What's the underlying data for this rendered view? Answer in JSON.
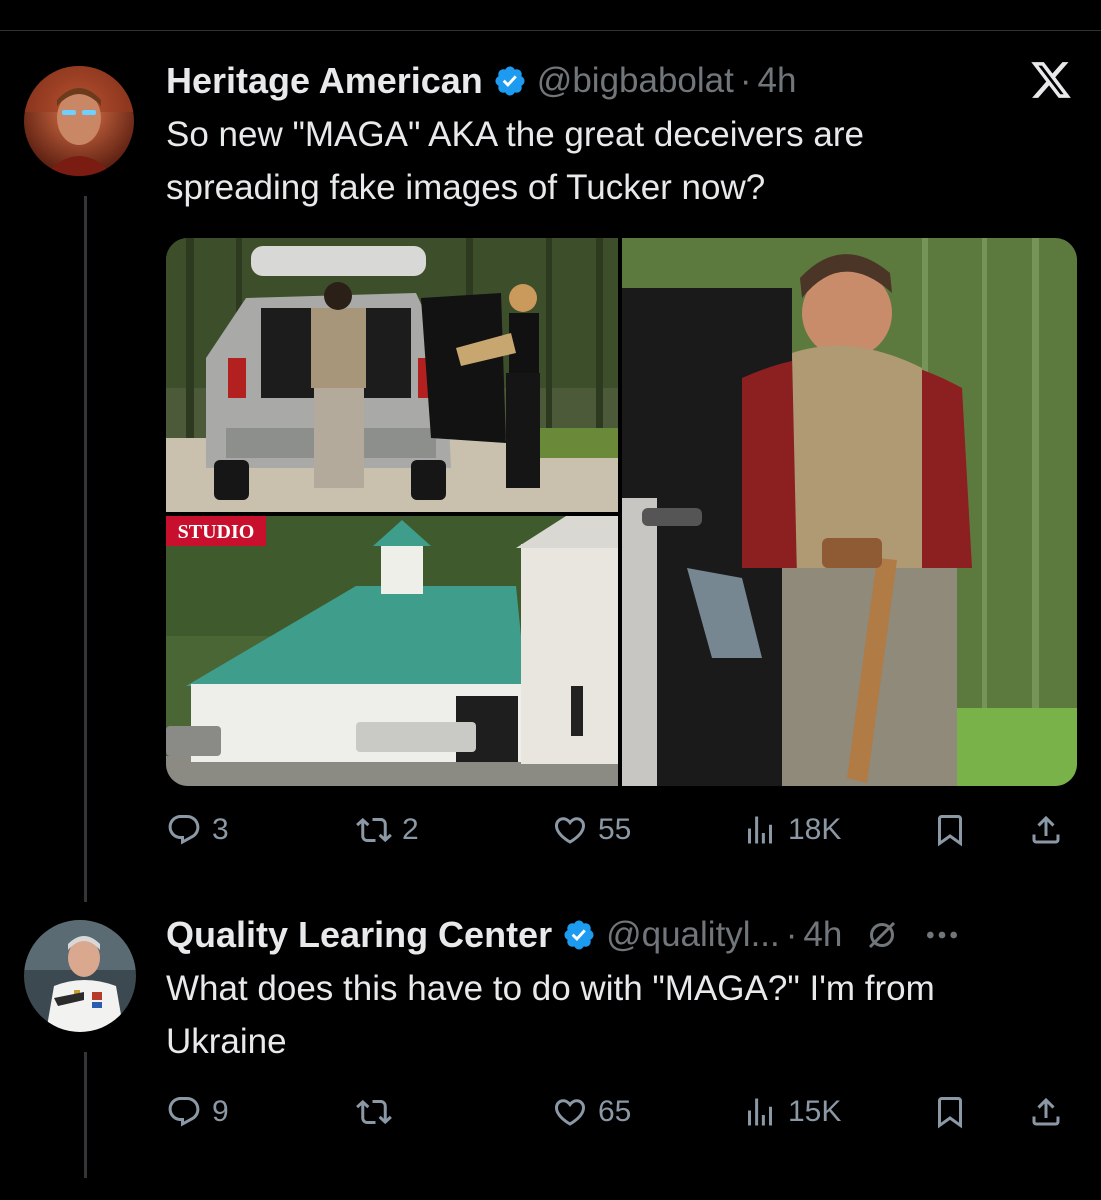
{
  "tweets": [
    {
      "display_name": "Heritage American",
      "handle": "@bigbabolat",
      "separator": "·",
      "time": "4h",
      "text": "So new \"MAGA\" AKA the great deceivers are spreading fake images of Tucker now?",
      "media_label": "STUDIO",
      "stats": {
        "replies": "3",
        "reposts": "2",
        "likes": "55",
        "views": "18K"
      }
    },
    {
      "display_name": "Quality Learing Center",
      "handle": "@qualityl...",
      "separator": "·",
      "time": "4h",
      "text": "What does this have to do with \"MAGA?\" I'm from Ukraine",
      "stats": {
        "replies": "9",
        "reposts": "",
        "likes": "65",
        "views": "15K"
      }
    }
  ],
  "icons": {
    "brand": "x-logo-icon",
    "verified": "verified-badge-icon",
    "reply": "reply-icon",
    "repost": "repost-icon",
    "like": "heart-icon",
    "views": "views-icon",
    "bookmark": "bookmark-icon",
    "share": "share-icon",
    "muted": "mute-icon",
    "more": "more-icon"
  },
  "colors": {
    "background": "#000000",
    "text": "#e7e9ea",
    "muted": "#71767b",
    "verified": "#1d9bf0",
    "studio_label": "#c8102e"
  }
}
